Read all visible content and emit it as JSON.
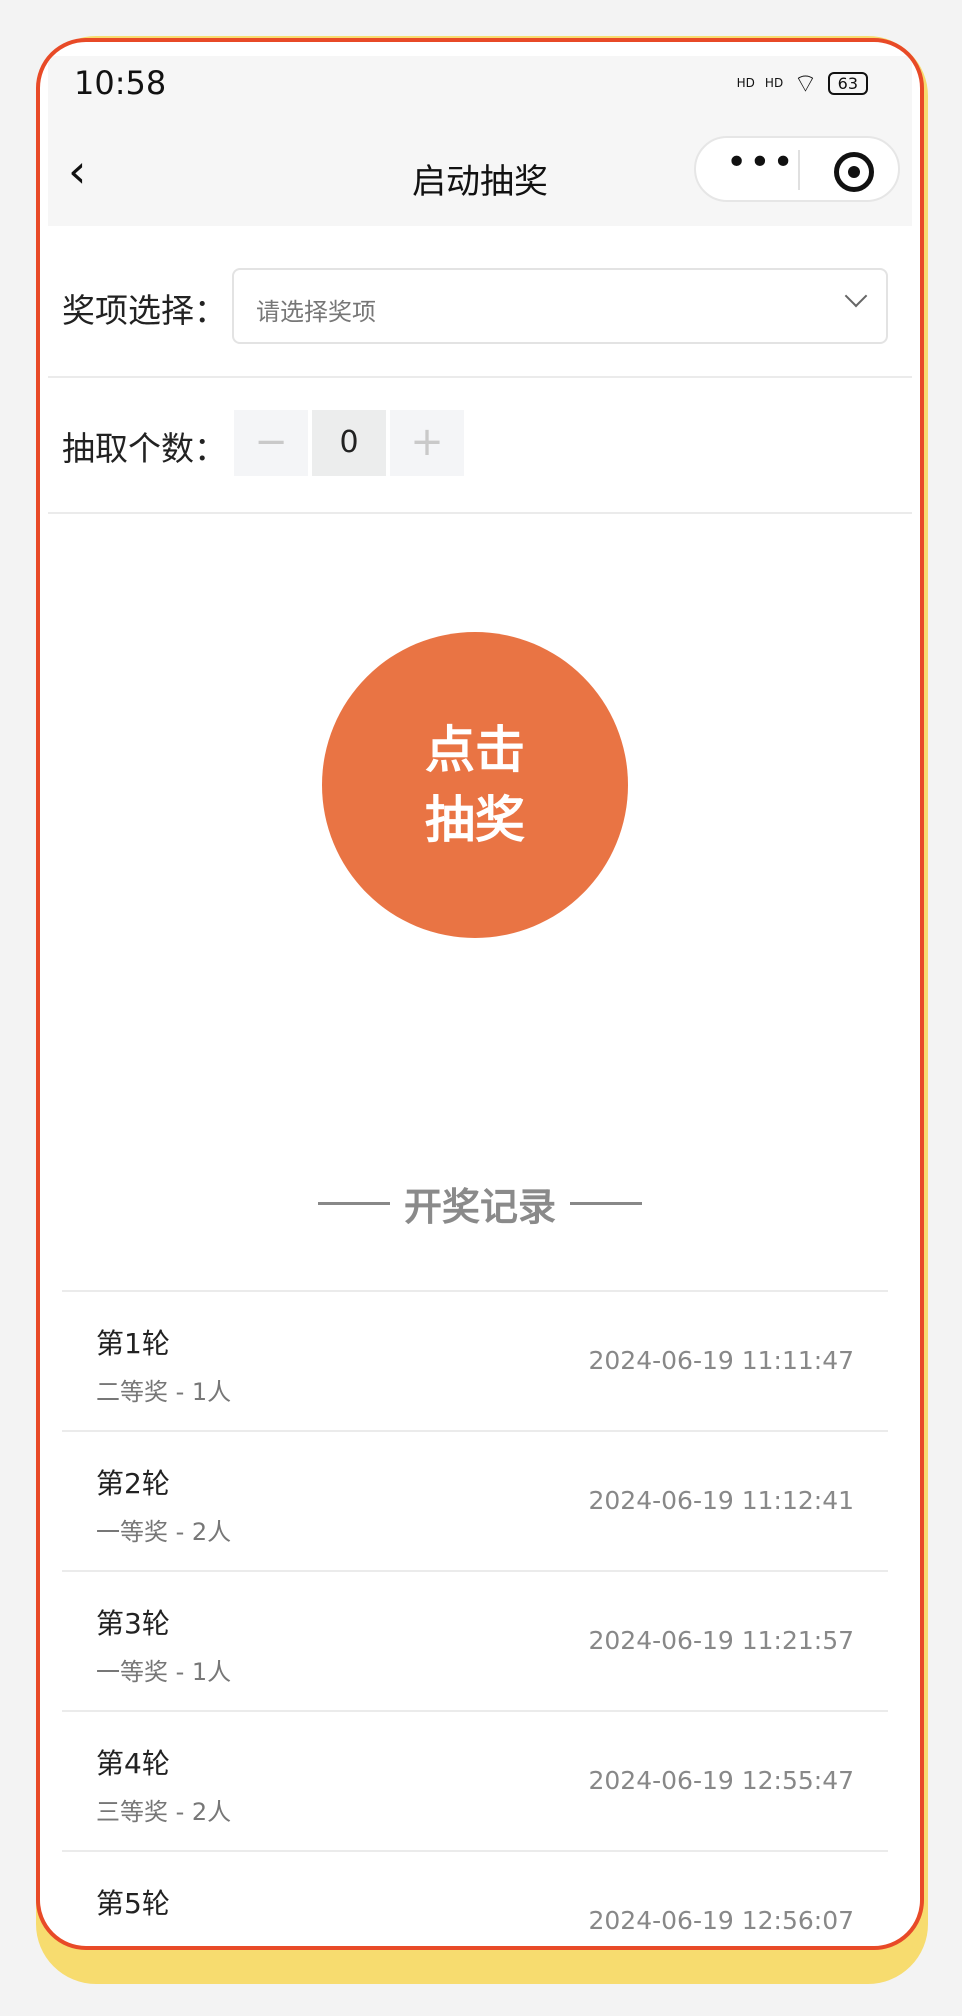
{
  "status_bar": {
    "time": "10:58",
    "signal1": "HD",
    "signal2": "HD",
    "battery": "63"
  },
  "nav": {
    "title": "启动抽奖",
    "back_icon": "chevron-left-icon",
    "more_icon": "more-dots-icon",
    "close_icon": "target-circle-icon"
  },
  "form": {
    "prize_label": "奖项选择：",
    "prize_placeholder": "请选择奖项",
    "count_label": "抽取个数：",
    "count_minus": "−",
    "count_value": "0",
    "count_plus": "+"
  },
  "draw_button": {
    "line1": "点击",
    "line2": "抽奖",
    "color": "#e97444"
  },
  "records": {
    "title": "开奖记录",
    "items": [
      {
        "round": "第1轮",
        "detail": "二等奖 - 1人",
        "time": "2024-06-19 11:11:47"
      },
      {
        "round": "第2轮",
        "detail": "一等奖 - 2人",
        "time": "2024-06-19 11:12:41"
      },
      {
        "round": "第3轮",
        "detail": "一等奖 - 1人",
        "time": "2024-06-19 11:21:57"
      },
      {
        "round": "第4轮",
        "detail": "三等奖 - 2人",
        "time": "2024-06-19 12:55:47"
      },
      {
        "round": "第5轮",
        "detail": "",
        "time": "2024-06-19 12:56:07"
      }
    ]
  },
  "colors": {
    "frame_border": "#e84a27",
    "frame_shadow": "#f7dc6f"
  }
}
